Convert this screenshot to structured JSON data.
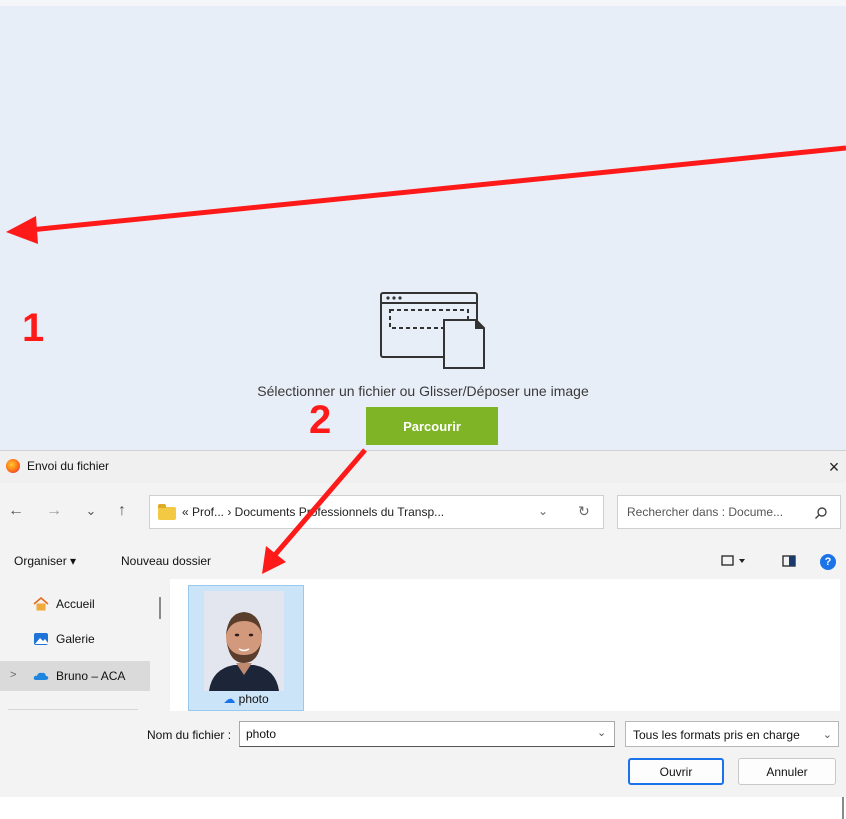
{
  "upload": {
    "instruction": "Sélectionner un fichier ou Glisser/Déposer une image",
    "browse_label": "Parcourir"
  },
  "annotations": {
    "step1": "1",
    "step2": "2",
    "arrow_color": "#ff1a1a"
  },
  "dialog": {
    "title": "Envoi du fichier",
    "close": "×",
    "nav": {
      "back": "←",
      "forward": "→",
      "recent": "⌄",
      "up": "↑"
    },
    "address": {
      "path": "« Prof... › Documents Professionnels du Transp...",
      "dropdown": "⌄",
      "refresh": "↻"
    },
    "search_placeholder": "Rechercher dans : Docume...",
    "toolbar": {
      "organize": "Organiser ▾",
      "new_folder": "Nouveau dossier"
    },
    "sidebar": {
      "items": [
        {
          "label": "Accueil",
          "icon": "home-icon"
        },
        {
          "label": "Galerie",
          "icon": "gallery-icon"
        },
        {
          "label": "Bruno – ACA",
          "icon": "onedrive-cloud-icon",
          "expand": ">"
        }
      ]
    },
    "files": [
      {
        "name": "photo",
        "cloud": "☁"
      }
    ],
    "filename_label": "Nom du fichier :",
    "filename_value": "photo",
    "filter_value": "Tous les formats pris en charge",
    "open_label": "Ouvrir",
    "cancel_label": "Annuler"
  },
  "colors": {
    "accent_green": "#7fb427",
    "selection_blue": "#cce4f7",
    "primary_blue": "#1a73e8"
  }
}
